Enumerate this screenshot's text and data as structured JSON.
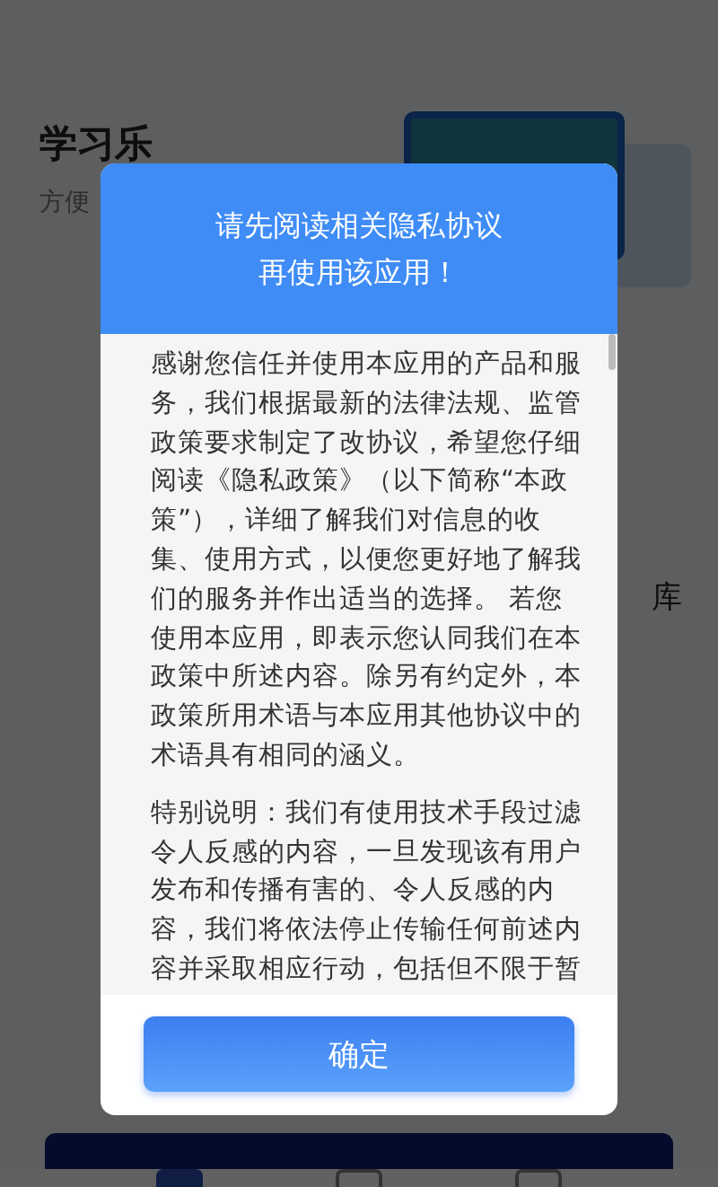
{
  "background": {
    "title": "学习乐",
    "subtitle": "方便",
    "side_text": "库"
  },
  "dialog": {
    "title_lines": [
      "请先阅读相关隐私协议",
      "再使用该应用！"
    ],
    "paragraphs": [
      "感谢您信任并使用本应用的产品和服务，我们根据最新的法律法规、监管政策要求制定了改协议，希望您仔细阅读《隐私政策》（以下简称“本政策”），详细了解我们对信息的收集、使用方式，以便您更好地了解我们的服务并作出适当的选择。 若您使用本应用，即表示您认同我们在本政策中所述内容。除另有约定外，本政策所用术语与本应用其他协议中的术语具有相同的涵义。",
      "特别说明：我们有使用技术手段过滤令人反感的内容，一旦发现该有用户发布和传播有害的、令人反感的内容，我们将依法停止传输任何前述内容并采取相应行动，包括但不限于暂"
    ],
    "confirm_button": "确定"
  }
}
